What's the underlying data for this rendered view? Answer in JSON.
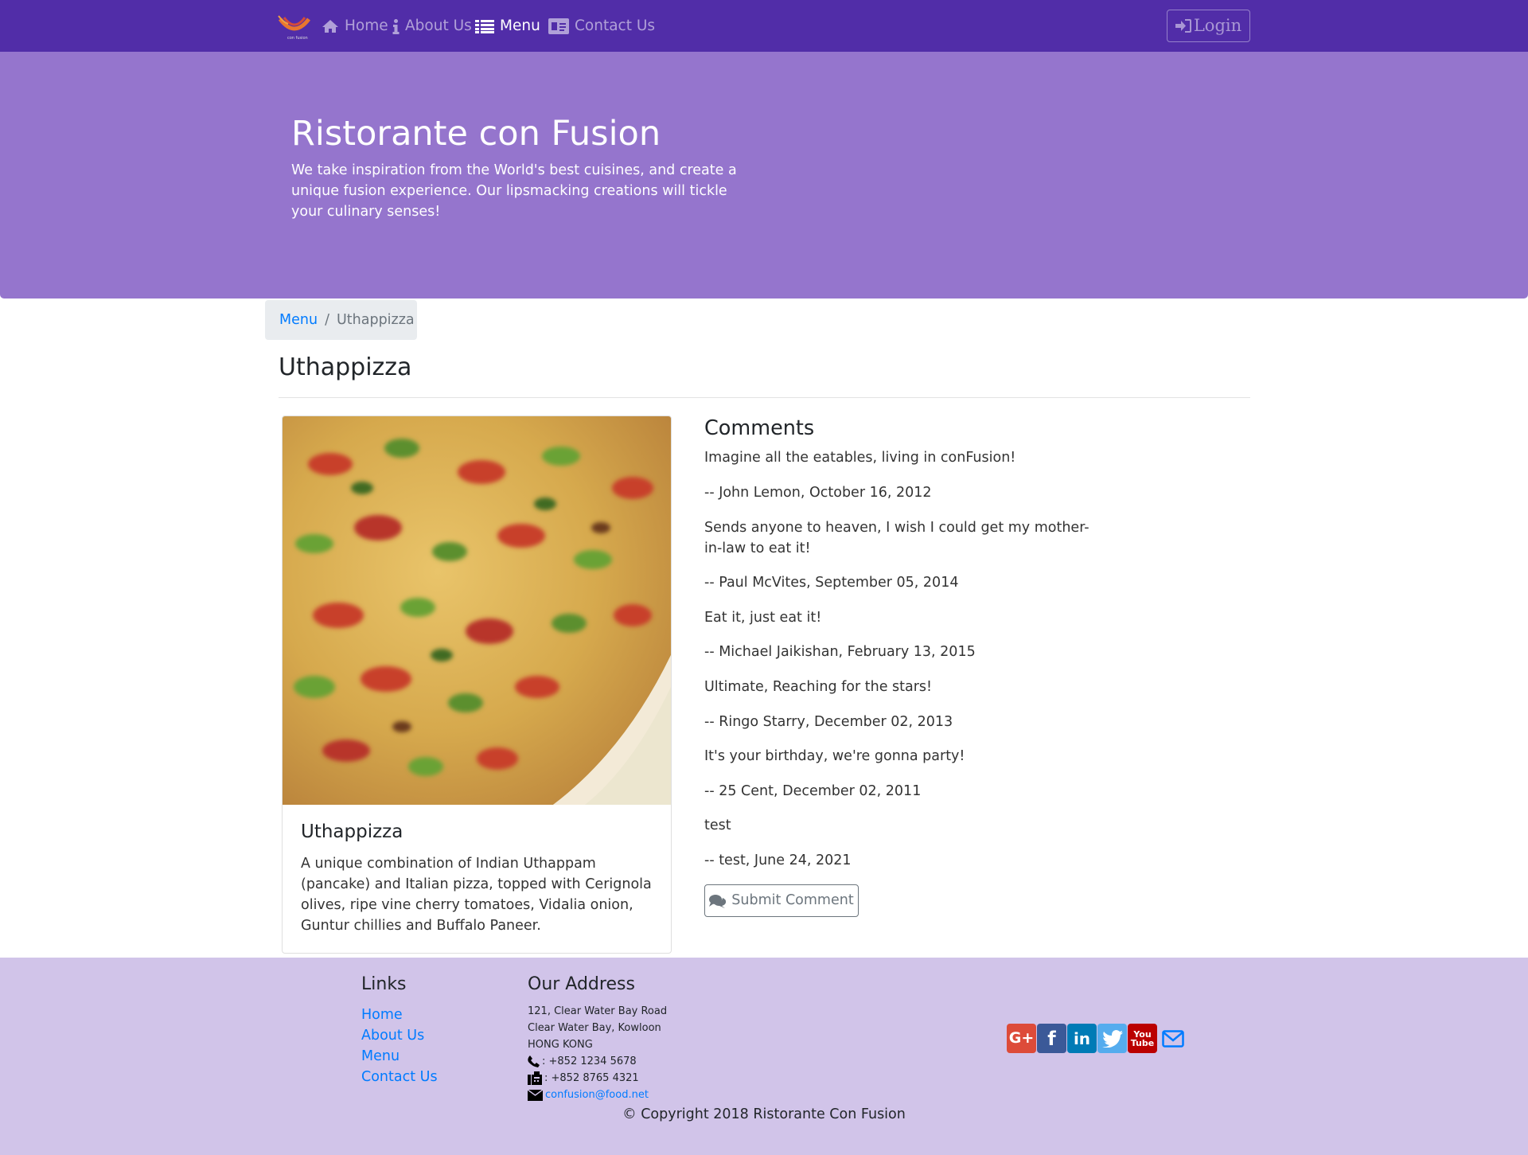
{
  "nav": {
    "items": [
      {
        "label": "Home",
        "icon": "home-icon"
      },
      {
        "label": "About Us",
        "icon": "info-icon"
      },
      {
        "label": "Menu",
        "icon": "list-icon"
      },
      {
        "label": "Contact Us",
        "icon": "address-card-icon"
      }
    ],
    "active": "Menu",
    "login_label": "Login"
  },
  "jumbotron": {
    "title": "Ristorante con Fusion",
    "text": "We take inspiration from the World's best cuisines, and create a unique fusion experience. Our lipsmacking creations will tickle your culinary senses!"
  },
  "breadcrumb": {
    "parent": "Menu",
    "current": "Uthappizza"
  },
  "page_title": "Uthappizza",
  "dish": {
    "name": "Uthappizza",
    "description": "A unique combination of Indian Uthappam (pancake) and Italian pizza, topped with Cerignola olives, ripe vine cherry tomatoes, Vidalia onion, Guntur chillies and Buffalo Paneer."
  },
  "comments": {
    "title": "Comments",
    "items": [
      {
        "text": "Imagine all the eatables, living in conFusion!",
        "byline": "-- John Lemon,  October 16, 2012"
      },
      {
        "text": "Sends anyone to heaven, I wish I could get my mother-in-law to eat it!",
        "byline": "-- Paul McVites,  September 05, 2014"
      },
      {
        "text": "Eat it, just eat it!",
        "byline": "-- Michael Jaikishan,  February 13, 2015"
      },
      {
        "text": "Ultimate, Reaching for the stars!",
        "byline": "-- Ringo Starry,  December 02, 2013"
      },
      {
        "text": "It's your birthday, we're gonna party!",
        "byline": "-- 25 Cent,  December 02, 2011"
      },
      {
        "text": "test",
        "byline": "-- test,  June 24, 2021"
      }
    ],
    "submit_label": "Submit Comment"
  },
  "footer": {
    "links_title": "Links",
    "links": [
      "Home",
      "About Us",
      "Menu",
      "Contact Us"
    ],
    "address_title": "Our Address",
    "address_lines": [
      "121, Clear Water Bay Road",
      "Clear Water Bay, Kowloon",
      "HONG KONG"
    ],
    "phone": ": +852 1234 5678",
    "fax": ": +852 8765 4321",
    "email": "confusion@food.net",
    "social": [
      "google-plus-icon",
      "facebook-icon",
      "linkedin-icon",
      "twitter-icon",
      "youtube-icon",
      "mail-icon"
    ],
    "copyright": "© Copyright 2018 Ristorante Con Fusion"
  },
  "colors": {
    "navbar": "#512da8",
    "jumbotron": "#9575cd",
    "footer": "#d1c4e9",
    "link": "#007bff"
  }
}
